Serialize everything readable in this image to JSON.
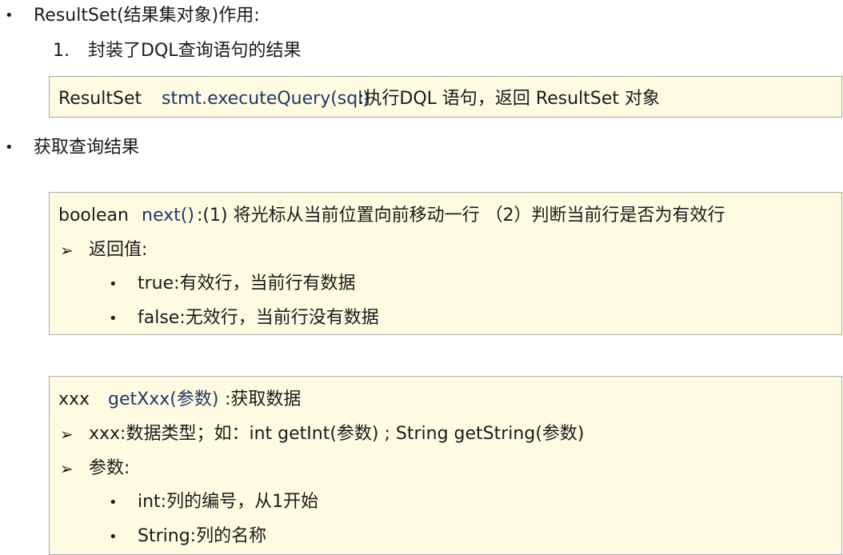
{
  "section1": {
    "bullet": "•",
    "title": "ResultSet(结果集对象)作用:",
    "item_num": "1.",
    "item_text": "封装了DQL查询语句的结果",
    "box": {
      "type": "ResultSet",
      "method": "stmt.executeQuery(sql)",
      "desc": ":执行DQL 语句，返回 ResultSet 对象"
    }
  },
  "section2": {
    "bullet": "•",
    "title": "获取查询结果",
    "next_box": {
      "type": "boolean",
      "method": "next()",
      "desc": ":(1) 将光标从当前位置向前移动一行  （2）判断当前行是否为有效行",
      "arrow": "➢",
      "sub_title": "返回值:",
      "items": [
        "true:有效行，当前行有数据",
        "false:无效行，当前行没有数据"
      ]
    },
    "get_box": {
      "type": "xxx",
      "method": "getXxx(参数)",
      "desc": ":获取数据",
      "arrow": "➢",
      "line1": "xxx:数据类型；如：int getInt(参数) ; String getString(参数)",
      "line2": "参数:",
      "items": [
        "int:列的编号，从1开始",
        "String:列的名称"
      ]
    }
  }
}
